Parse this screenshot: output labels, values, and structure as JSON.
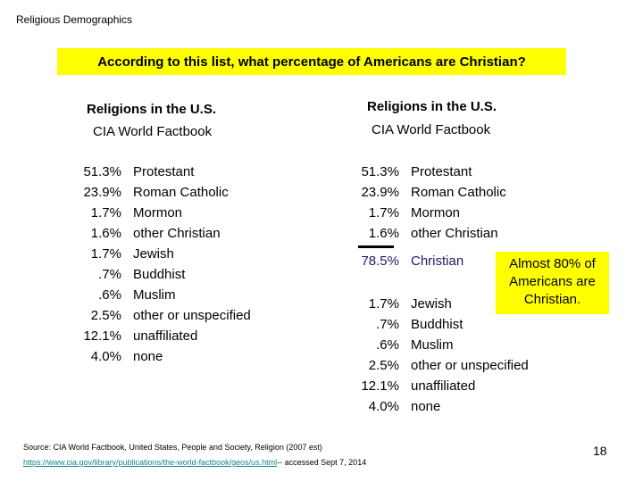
{
  "slide": {
    "title": "Religious Demographics",
    "question": "According to this list, what percentage of Americans are Christian?",
    "page_number": "18"
  },
  "colors": {
    "highlight": "#ffff00",
    "christian_total": "#1a1a66",
    "link": "#138585"
  },
  "left_panel": {
    "heading": "Religions in the U.S.",
    "subheading": "CIA World Factbook",
    "rows": [
      {
        "pct": "51.3%",
        "name": "Protestant"
      },
      {
        "pct": "23.9%",
        "name": "Roman Catholic"
      },
      {
        "pct": "1.7%",
        "name": "Mormon"
      },
      {
        "pct": "1.6%",
        "name": "other Christian"
      },
      {
        "pct": "1.7%",
        "name": "Jewish"
      },
      {
        "pct": ".7%",
        "name": "Buddhist"
      },
      {
        "pct": ".6%",
        "name": "Muslim"
      },
      {
        "pct": "2.5%",
        "name": "other or unspecified"
      },
      {
        "pct": "12.1%",
        "name": "unaffiliated"
      },
      {
        "pct": "4.0%",
        "name": "none"
      }
    ]
  },
  "right_panel": {
    "heading": "Religions in the U.S.",
    "subheading": "CIA World Factbook",
    "christian_rows": [
      {
        "pct": "51.3%",
        "name": "Protestant"
      },
      {
        "pct": "23.9%",
        "name": "Roman Catholic"
      },
      {
        "pct": "1.7%",
        "name": "Mormon"
      },
      {
        "pct": "1.6%",
        "name": "other Christian"
      }
    ],
    "total": {
      "pct": "78.5%",
      "name": "Christian"
    },
    "other_rows": [
      {
        "pct": "1.7%",
        "name": "Jewish"
      },
      {
        "pct": ".7%",
        "name": "Buddhist"
      },
      {
        "pct": ".6%",
        "name": "Muslim"
      },
      {
        "pct": "2.5%",
        "name": "other or unspecified"
      },
      {
        "pct": "12.1%",
        "name": "unaffiliated"
      },
      {
        "pct": "4.0%",
        "name": "none"
      }
    ],
    "callout": "Almost 80% of Americans are Christian."
  },
  "source": {
    "text": "Source: CIA World Factbook, United States, People and Society, Religion (2007 est)",
    "link_text": "https://www.cia.gov/library/publications/the-world-factbook/geos/us.html",
    "accessed": "-- accessed Sept 7, 2014"
  }
}
